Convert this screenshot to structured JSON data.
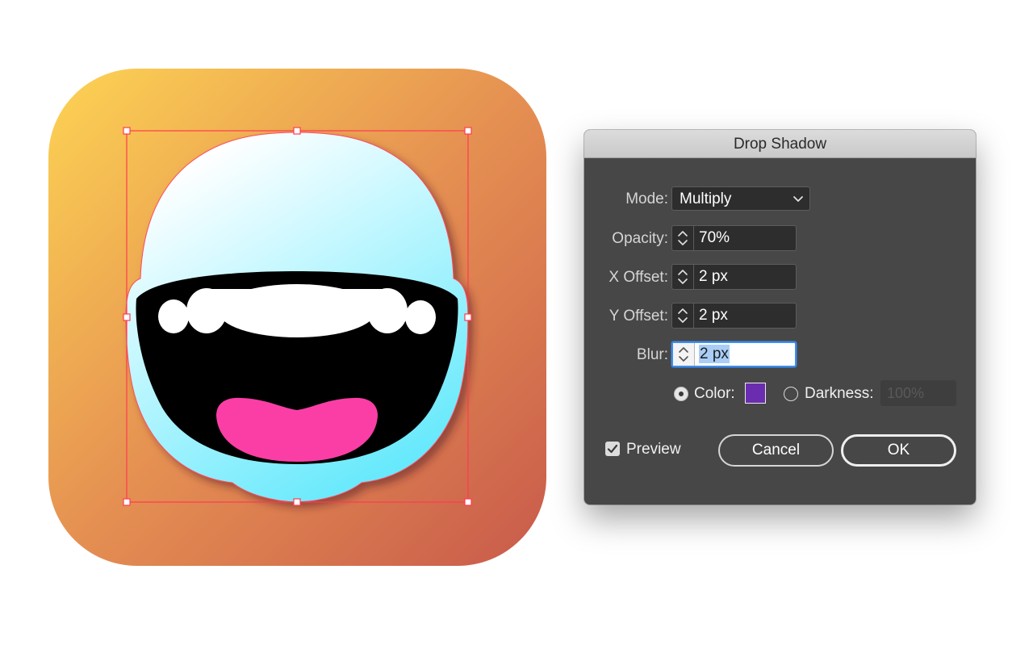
{
  "dialog": {
    "title": "Drop Shadow",
    "mode": {
      "label": "Mode:",
      "value": "Multiply"
    },
    "opacity": {
      "label": "Opacity:",
      "value": "70%"
    },
    "x_offset": {
      "label": "X Offset:",
      "value": "2 px"
    },
    "y_offset": {
      "label": "Y Offset:",
      "value": "2 px"
    },
    "blur": {
      "label": "Blur:",
      "value": "2 px"
    },
    "color": {
      "label": "Color:",
      "selected": true,
      "swatch": "#6a2db0"
    },
    "darkness": {
      "label": "Darkness:",
      "value": "100%",
      "selected": false,
      "disabled": true
    },
    "preview": {
      "label": "Preview",
      "checked": true
    },
    "cancel_label": "Cancel",
    "ok_label": "OK"
  },
  "artwork": {
    "background_gradient": [
      "#fdd453",
      "#e0874f",
      "#c85a4b"
    ],
    "face_gradient": [
      "#ffffff",
      "#6eeafd"
    ],
    "mouth_color": "#000000",
    "tongue_color": "#fb3ea6",
    "selection_color": "#ff3b4f"
  }
}
